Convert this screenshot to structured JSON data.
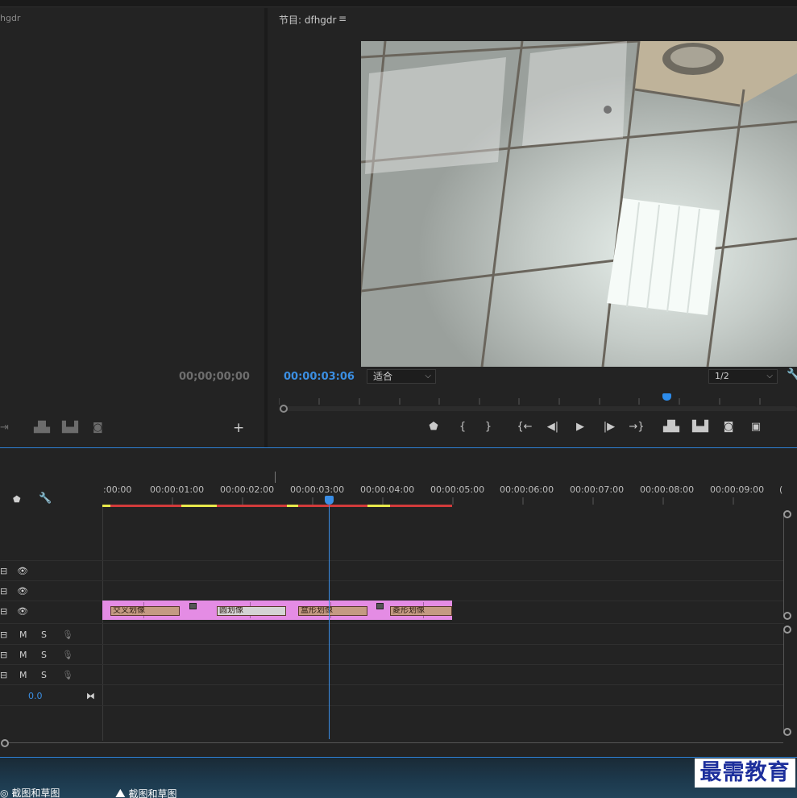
{
  "source_monitor": {
    "title": "hgdr",
    "timecode": "00;00;00;00",
    "buttons": [
      "insert-icon",
      "lift-icon",
      "extract-icon",
      "camera-icon"
    ],
    "add_label": "+"
  },
  "program_monitor": {
    "title": "节目: dfhgdr",
    "menu_label": "≡",
    "timecode": "00:00:03:06",
    "fit_option": "适合",
    "resolution_option": "1/2",
    "controls": [
      "add-marker-icon",
      "mark-in-icon",
      "mark-out-icon",
      "go-to-in-icon",
      "step-back-icon",
      "play-icon",
      "step-forward-icon",
      "go-to-out-icon",
      "lift-icon",
      "extract-icon",
      "export-frame-icon",
      "compare-icon"
    ]
  },
  "timeline": {
    "ruler_labels": [
      ":00:00",
      "00:00:01:00",
      "00:00:02:00",
      "00:00:03:00",
      "00:00:04:00",
      "00:00:05:00",
      "00:00:06:00",
      "00:00:07:00",
      "00:00:08:00",
      "00:00:09:00",
      "("
    ],
    "video_tracks": 3,
    "audio_tracks": 3,
    "audio_labels": {
      "mute": "M",
      "solo": "S"
    },
    "master_volume": "0.0",
    "transitions": [
      "交叉划像",
      "圆划像",
      "盒形划像",
      "菱形划像"
    ],
    "colors": {
      "clip": "#e48ce4",
      "transition": "#c49a82",
      "playhead": "#3a8ee6",
      "render_red": "#d23b3b",
      "render_yellow": "#e8e84a"
    }
  },
  "taskbar": {
    "items": [
      "截图和草图",
      "截图和草图"
    ]
  },
  "watermark": "最需教育"
}
